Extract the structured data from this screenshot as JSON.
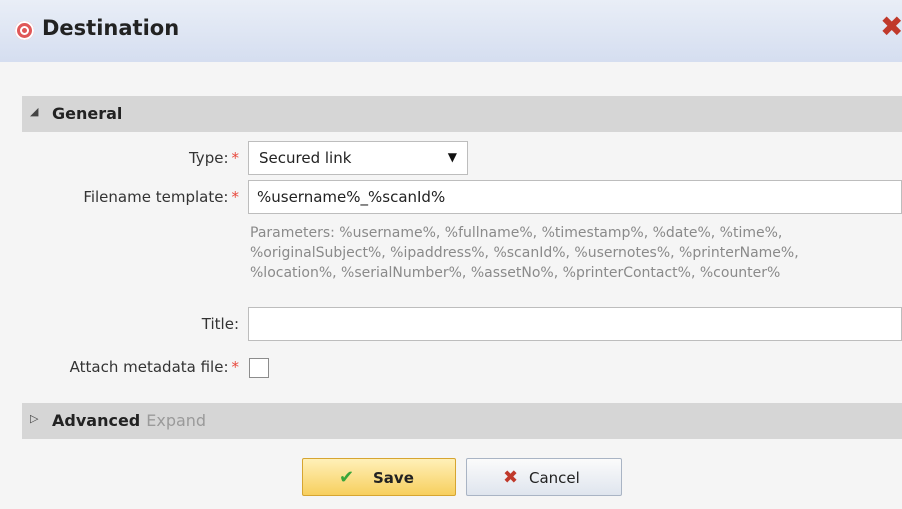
{
  "window": {
    "title": "Destination",
    "close_symbol": "✖"
  },
  "sections": {
    "general": {
      "arrow": "◢",
      "label": "General"
    },
    "advanced": {
      "arrow": "▷",
      "label": "Advanced",
      "hint": "Expand"
    }
  },
  "form": {
    "required_marker": "*",
    "type": {
      "label": "Type:",
      "value": "Secured link",
      "caret": "▼"
    },
    "filename_template": {
      "label": "Filename template:",
      "value": "%username%_%scanId%",
      "parameters_lines": [
        "Parameters: %username%, %fullname%, %timestamp%, %date%, %time%,",
        "%originalSubject%, %ipaddress%, %scanId%, %usernotes%, %printerName%,",
        "%location%, %serialNumber%, %assetNo%, %printerContact%, %counter%"
      ]
    },
    "title": {
      "label": "Title:",
      "value": ""
    },
    "attach_metadata": {
      "label": "Attach metadata file:",
      "checked": false
    }
  },
  "buttons": {
    "save": {
      "label": "Save",
      "icon": "✔"
    },
    "cancel": {
      "label": "Cancel",
      "icon": "✖"
    }
  },
  "colors": {
    "required": "#e8483c",
    "save_bg": "#f7cf5e",
    "close": "#c0392b"
  }
}
